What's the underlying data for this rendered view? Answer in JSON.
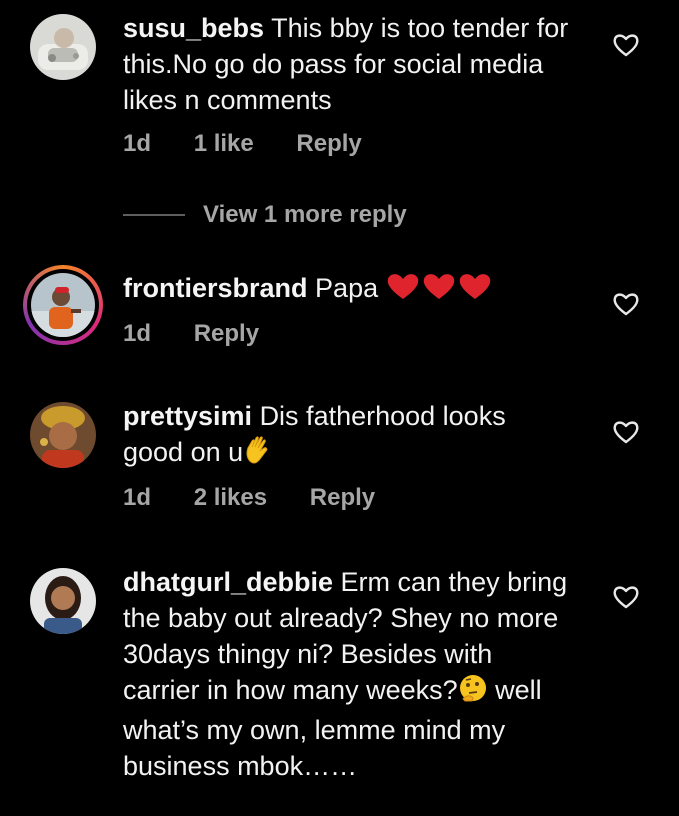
{
  "comments": [
    {
      "username": "susu_bebs",
      "text": "This bby is too tender for this.No go do pass for social media likes n comments",
      "time": "1d",
      "likes": "1 like",
      "reply": "Reply"
    },
    {
      "username": "frontiersbrand",
      "text": "Papa",
      "emoji": "❤️❤️❤️",
      "time": "1d",
      "reply": "Reply"
    },
    {
      "username": "prettysimi",
      "text": "Dis fatherhood looks good on u",
      "emoji": "👋",
      "time": "1d",
      "likes": "2 likes",
      "reply": "Reply"
    },
    {
      "username": "dhatgurl_debbie",
      "text_part1": "Erm can they bring the baby out already? Shey no more 30days thingy ni? Besides with carrier in how many weeks?",
      "emoji": "🤔",
      "text_part2": " well what’s my own, lemme mind my business mbok……"
    }
  ],
  "view_more_replies": "View 1 more reply",
  "icons": {
    "like": "heart-outline-icon",
    "story_ring": "story-ring"
  },
  "colors": {
    "background": "#000000",
    "text": "#f2f2f2",
    "meta": "#a6a6a6",
    "heart_red": "#e0242e"
  }
}
